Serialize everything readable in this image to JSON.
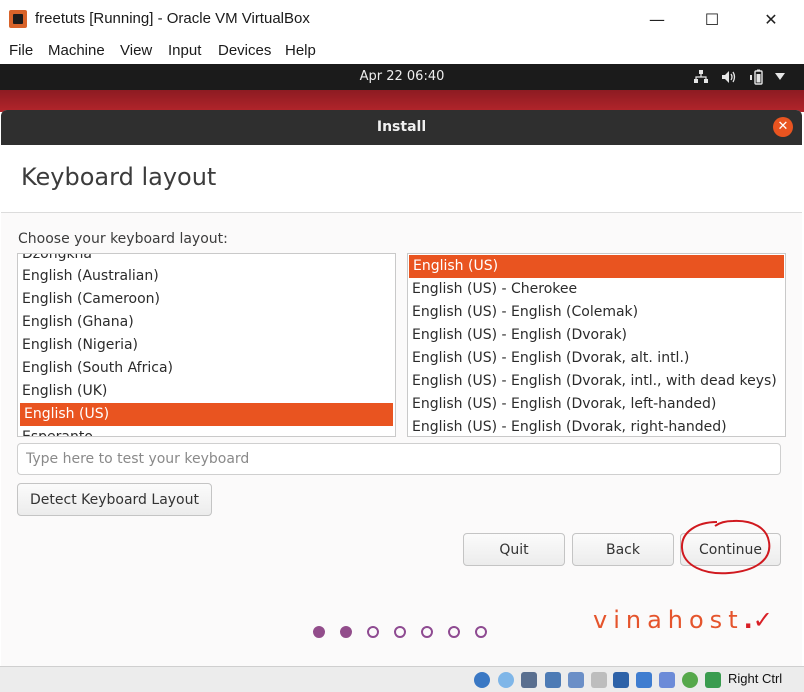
{
  "window": {
    "title": "freetuts [Running] - Oracle VM VirtualBox",
    "minimize_glyph": "—",
    "maximize_glyph": "☐",
    "close_glyph": "✕"
  },
  "menu": [
    "File",
    "Machine",
    "View",
    "Input",
    "Devices",
    "Help"
  ],
  "topbar": {
    "clock": "Apr 22  06:40",
    "icons": [
      "network-icon",
      "volume-icon",
      "battery-icon",
      "menu-arrow-icon"
    ]
  },
  "dialog": {
    "title": "Install",
    "close_glyph": "✕",
    "heading": "Keyboard layout",
    "choose_label": "Choose your keyboard layout:",
    "layouts": [
      "Dzongkha",
      "English (Australian)",
      "English (Cameroon)",
      "English (Ghana)",
      "English (Nigeria)",
      "English (South Africa)",
      "English (UK)",
      "English (US)",
      "Esperanto"
    ],
    "layouts_selected": "English (US)",
    "variants": [
      "English (US)",
      "English (US) - Cherokee",
      "English (US) - English (Colemak)",
      "English (US) - English (Dvorak)",
      "English (US) - English (Dvorak, alt. intl.)",
      "English (US) - English (Dvorak, intl., with dead keys)",
      "English (US) - English (Dvorak, left-handed)",
      "English (US) - English (Dvorak, right-handed)"
    ],
    "variants_selected": "English (US)",
    "test_placeholder": "Type here to test your keyboard",
    "detect_label": "Detect Keyboard Layout",
    "quit_label": "Quit",
    "back_label": "Back",
    "continue_label": "Continue",
    "progress": {
      "total_steps": 7,
      "completed_steps": 2
    }
  },
  "watermark": {
    "text": "vinahost",
    "mark": ".✓"
  },
  "statusbar": {
    "host_key": "Right Ctrl"
  },
  "colors": {
    "accent": "#e95420",
    "annotation_red": "#d0191f",
    "progress_dot": "#924d8b",
    "header_bg": "#2f2f2f",
    "topbar_bg": "#1b1b1b"
  }
}
